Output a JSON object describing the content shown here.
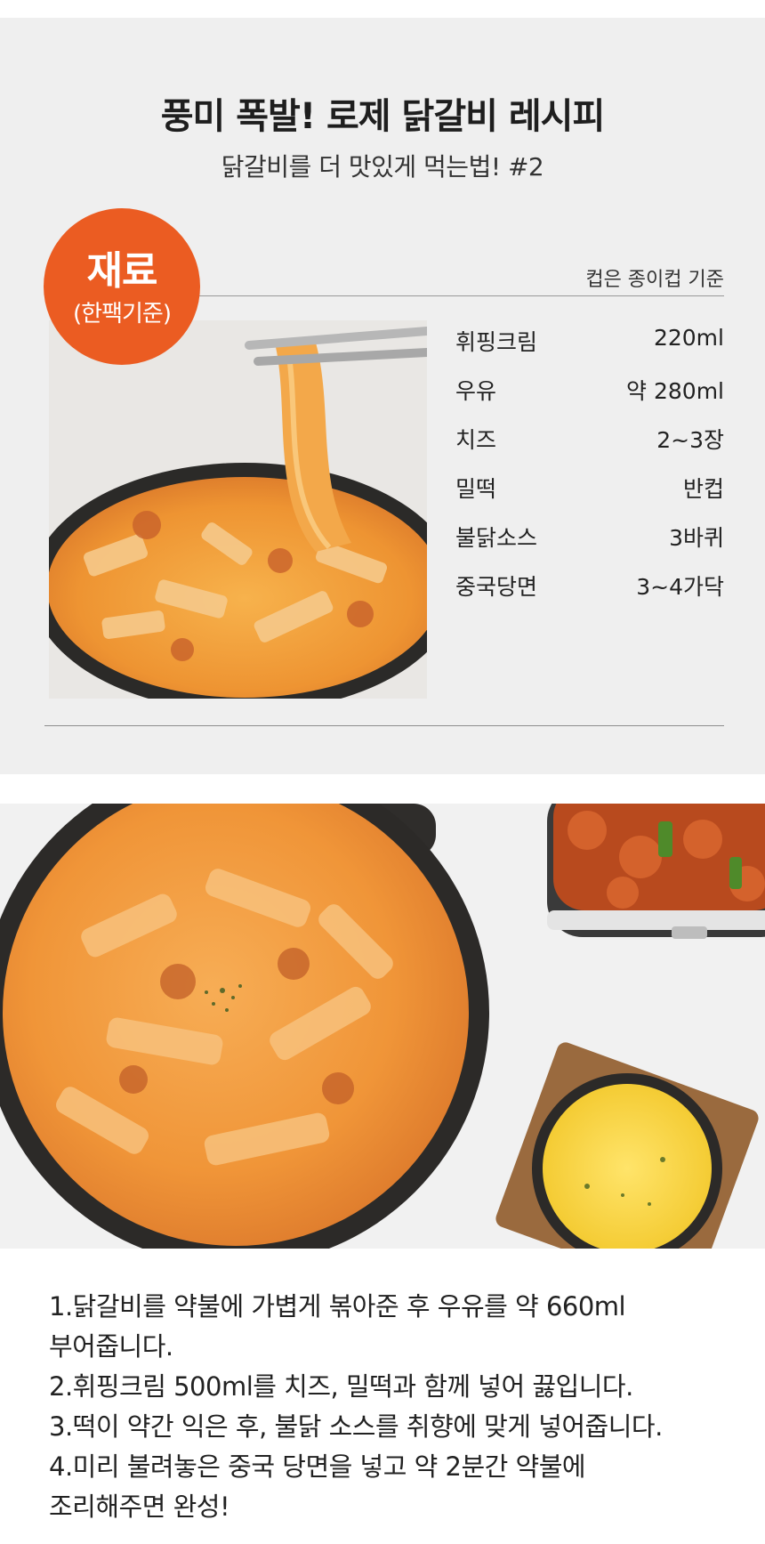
{
  "header": {
    "title": "풍미 폭발! 로제 닭갈비 레시피",
    "subtitle": "닭갈비를 더 맛있게 먹는법! #2"
  },
  "badge": {
    "title": "재료",
    "subtitle": "(한팩기준)"
  },
  "cup_note": "컵은 종이컵 기준",
  "ingredients": [
    {
      "name": "휘핑크림",
      "amount": "220ml"
    },
    {
      "name": "우유",
      "amount": "약 280ml"
    },
    {
      "name": "치즈",
      "amount": "2~3장"
    },
    {
      "name": "밀떡",
      "amount": "반컵"
    },
    {
      "name": "불닭소스",
      "amount": "3바퀴"
    },
    {
      "name": "중국당면",
      "amount": "3~4가닥"
    }
  ],
  "steps": [
    "1.닭갈비를 약불에 가볍게 볶아준 후 우유를 약 660ml",
    "부어줍니다.",
    "2.휘핑크림 500ml를 치즈, 밀떡과 함께 넣어 끓입니다.",
    "3.떡이 약간 익은 후, 불닭 소스를 취향에 맞게 넣어줍니다.",
    "4.미리 불려놓은 중국 당면을 넣고 약 2분간 약불에",
    "조리해주면 완성!"
  ],
  "colors": {
    "accent": "#eb5c22",
    "section_bg": "#efefef",
    "sauce": "#f0a040"
  }
}
